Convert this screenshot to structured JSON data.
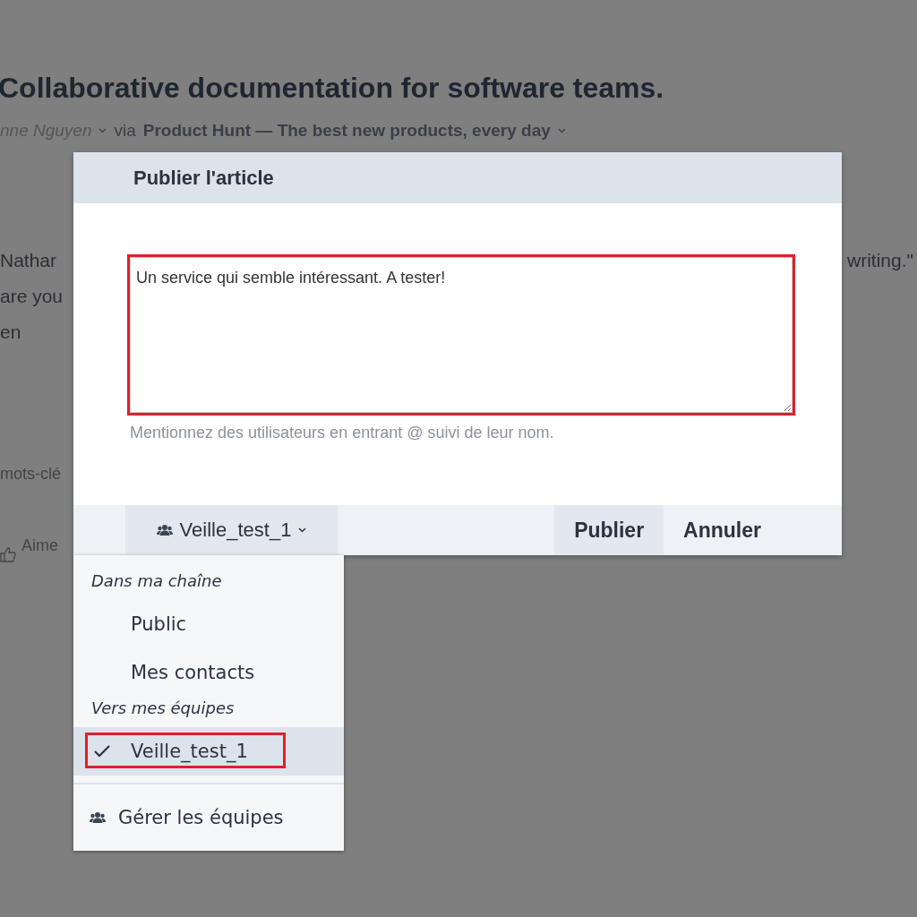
{
  "page": {
    "title": "Collaborative documentation for software teams.",
    "author": "nne Nguyen",
    "via": "via",
    "source": "Product Hunt — The best new products, every day",
    "left_fragments": [
      "Nathar",
      "are you",
      "en"
    ],
    "right_fragment": "writing.\"",
    "tags_fragment": "mots-clé",
    "like_fragment": "Aime"
  },
  "dialog": {
    "title": "Publier l'article",
    "comment": {
      "value": "Un service qui semble intéressant. A tester!",
      "highlighted": true
    },
    "hint": "Mentionnez des utilisateurs en entrant @ suivi de leur nom.",
    "audience": "Veille_test_1",
    "buttons": [
      {
        "label": "Publier",
        "kind": "primary"
      },
      {
        "label": "Annuler",
        "kind": "plain"
      }
    ]
  },
  "menu": {
    "sections": [
      {
        "heading": "Dans ma chaîne",
        "items": [
          {
            "label": "Public",
            "selected": false,
            "highlighted": false
          },
          {
            "label": "Mes contacts",
            "selected": false,
            "highlighted": false
          }
        ]
      },
      {
        "heading": "Vers mes équipes",
        "items": [
          {
            "label": "Veille_test_1",
            "selected": true,
            "highlighted": true
          }
        ]
      }
    ],
    "footer": "Gérer les équipes"
  }
}
